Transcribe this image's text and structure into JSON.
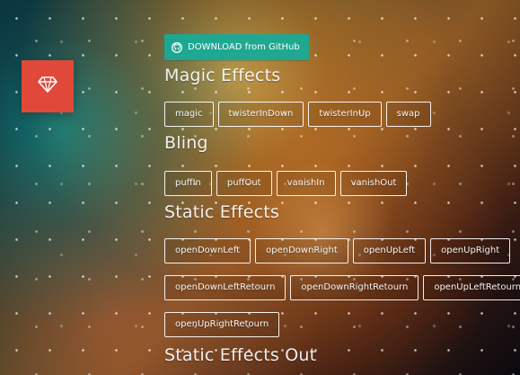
{
  "app": {
    "download_label": "DOWNLOAD from GitHub",
    "accent_download": "#18AA96",
    "accent_logo": "#E0493A"
  },
  "sections": [
    {
      "title": "Magic Effects",
      "rows": [
        [
          "magic",
          "twisterInDown",
          "twisterInUp",
          "swap"
        ]
      ]
    },
    {
      "title": "Bling",
      "rows": [
        [
          "puffIn",
          "puffOut",
          "vanishIn",
          "vanishOut"
        ]
      ]
    },
    {
      "title": "Static Effects",
      "rows": [
        [
          "openDownLeft",
          "openDownRight",
          "openUpLeft",
          "openUpRight"
        ],
        [
          "openDownLeftRetourn",
          "openDownRightRetourn",
          "openUpLeftRetourn"
        ],
        [
          "openUpRightRetourn"
        ]
      ]
    },
    {
      "title": "Static Effects Out",
      "rows": []
    }
  ],
  "icons": {
    "logo": "diamond-icon",
    "download": "github-icon"
  }
}
